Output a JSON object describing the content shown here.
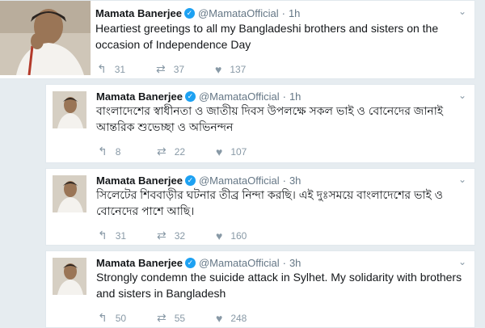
{
  "tweets": [
    {
      "name": "Mamata Banerjee",
      "handle": "@MamataOfficial",
      "time": "1h",
      "text": "Heartiest greetings to all my Bangladeshi brothers and sisters on the occasion of Independence Day",
      "replies": "31",
      "retweets": "37",
      "likes": "137"
    },
    {
      "name": "Mamata Banerjee",
      "handle": "@MamataOfficial",
      "time": "1h",
      "text": "বাংলাদেশের স্বাধীনতা ও জাতীয় দিবস উপলক্ষে সকল ভাই ও বোনেদের জানাই আন্তরিক শুভেচ্ছা ও অভিনন্দন",
      "replies": "8",
      "retweets": "22",
      "likes": "107"
    },
    {
      "name": "Mamata Banerjee",
      "handle": "@MamataOfficial",
      "time": "3h",
      "text": "সিলেটের শিববাড়ীর ঘটনার তীব্র নিন্দা করছি। এই দুঃসময়ে বাংলাদেশের ভাই ও বোনেদের পাশে আছি।",
      "replies": "31",
      "retweets": "32",
      "likes": "160"
    },
    {
      "name": "Mamata Banerjee",
      "handle": "@MamataOfficial",
      "time": "3h",
      "text": "Strongly condemn the suicide attack in Sylhet. My solidarity with brothers and sisters in Bangladesh",
      "replies": "50",
      "retweets": "55",
      "likes": "248"
    }
  ],
  "icons": {
    "verified": "verified-badge-icon",
    "reply": "reply-icon",
    "retweet": "retweet-icon",
    "like": "heart-icon",
    "menu": "chevron-down-icon"
  },
  "colors": {
    "verified": "#1da1f2",
    "muted": "#657786",
    "background": "#e6ecf0"
  }
}
